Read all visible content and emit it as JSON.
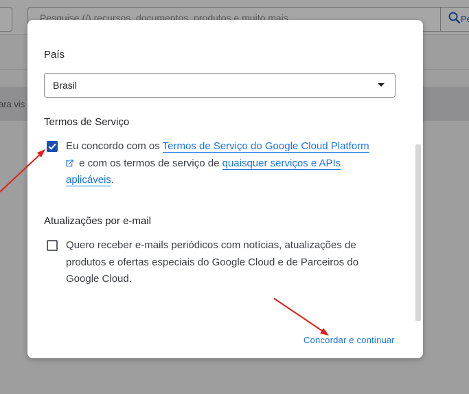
{
  "background": {
    "search_placeholder": "Pesquise (/) recursos, documentos, produtos e muito mais",
    "search_button_label": "Pe",
    "band_text": "ara vis"
  },
  "dialog": {
    "country": {
      "label": "País",
      "selected": "Brasil"
    },
    "terms": {
      "heading": "Termos de Serviço",
      "checked": true,
      "text_before": "Eu concordo com os ",
      "link1": "Termos de Serviço do Google Cloud Platform",
      "text_middle": " e com os termos de serviço de ",
      "link2": "quaisquer serviços e APIs aplicáveis",
      "text_after": "."
    },
    "email_updates": {
      "heading": "Atualizações por e-mail",
      "checked": false,
      "text": "Quero receber e-mails periódicos com notícias, atualizações de produtos e ofertas especiais do Google Cloud e de Parceiros do Google Cloud."
    },
    "action_label": "Concordar e continuar"
  },
  "colors": {
    "accent": "#1a73e8",
    "checkbox_checked": "#1a4fb0",
    "annotation_arrow": "#e0201e",
    "overlay": "#9e9e9e"
  }
}
